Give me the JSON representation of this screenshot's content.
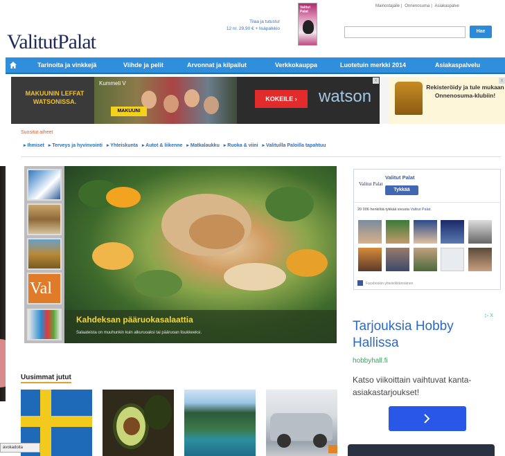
{
  "header": {
    "logo": "ValitutPalat",
    "logo_sub": "",
    "promo_line1": "Tilaa ja tutustu!",
    "promo_line2": "12 nr. 29,90 € + lisäpalkkio",
    "magazine_title": "Valitut Palat",
    "top_links": [
      "Mainostajalle",
      "Onnenosuma",
      "Asiakaspalve"
    ],
    "search_placeholder": "",
    "search_button": "Hae"
  },
  "nav": {
    "items": [
      "Tarinoita ja vinkkejä",
      "Viihde ja pelit",
      "Arvonnat ja kilpailut",
      "Verkkokauppa",
      "Luotetuin merkki 2014",
      "Asiakaspalvelu"
    ]
  },
  "ad_banner": {
    "left_text": "MAKUUNIN LEFFAT WATSONISSA.",
    "kummeli": "Kummeli V",
    "makuuni": "MAKUUNI",
    "cta": "KOKEILE ›",
    "brand": "watson",
    "close": "x",
    "club_text": "Rekisteröidy ja tule mukaan Onnenosuma-klubiin!"
  },
  "topics": {
    "label": "Suositut aiheet",
    "items": [
      "▸ Ihmiset",
      "▸ Terveys ja hyvinvointi",
      "▸ Yhteiskunta",
      "▸ Autot & liikenne",
      "▸ Matkalaukku",
      "▸ Ruoka & viini",
      "▸ Valituilla Paloilla tapahtuu"
    ]
  },
  "feature": {
    "title": "Kahdeksan pääruokasalaattia",
    "subtitle": "Salaateista on muuhunkin kuin alkuruoaksi tai pääruoan lisukkeeksi."
  },
  "facebook": {
    "logo": "Valitut Palat",
    "name": "Valitut Palat",
    "like": "Tykkää",
    "count_text": "20 006 henkilöä tykkää sivusta",
    "count_link": "Valitut Palat.",
    "plugin": "Facebookin yhteisöliitännäinen"
  },
  "ad_right": {
    "close": "▷ X",
    "title": "Tarjouksia Hobby Hallissa",
    "url": "hobbyhall.fi",
    "text": "Katso viikoittain vaihtuvat kanta-asiakastarjoukset!"
  },
  "latest": {
    "title": "Uusimmat jutut"
  },
  "status": {
    "text": "avokadoita"
  },
  "colors": {
    "nav": "#2f8fdd",
    "accent_red": "#e22b2b",
    "link": "#2b6fb5",
    "feature_title": "#f4d63a"
  }
}
